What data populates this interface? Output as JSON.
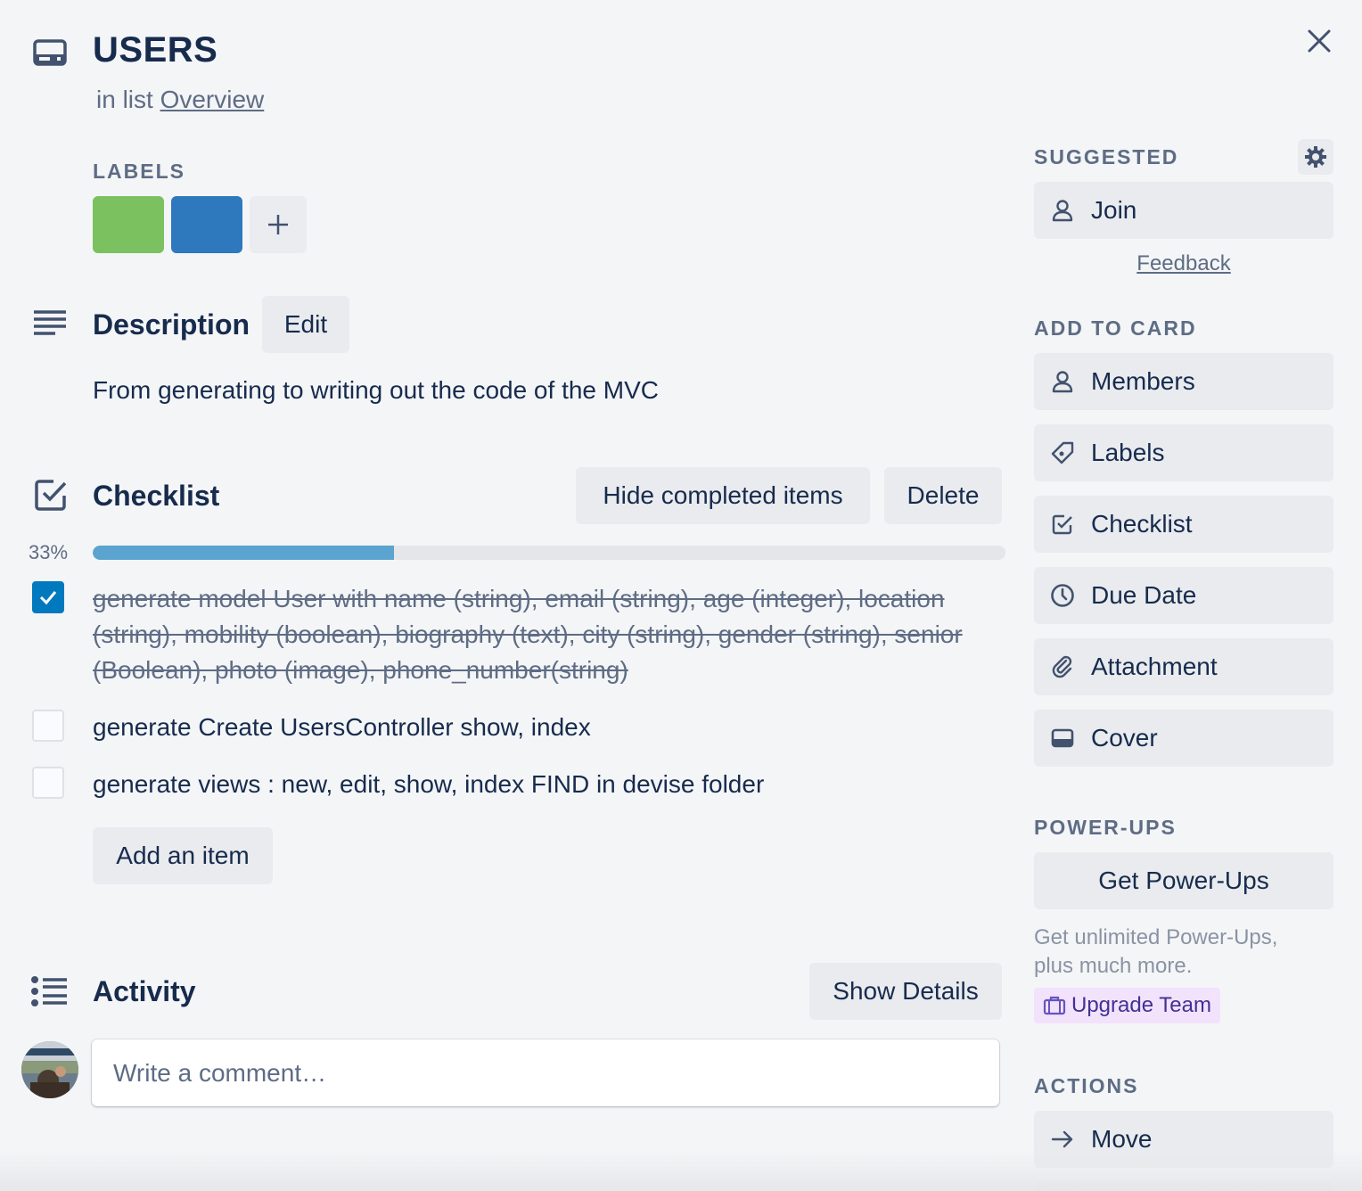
{
  "card": {
    "title": "USERS",
    "in_list_prefix": "in list",
    "list_name": "Overview"
  },
  "labels": {
    "heading": "LABELS",
    "chips": [
      {
        "color": "#7bc15f"
      },
      {
        "color": "#2e78bd"
      }
    ]
  },
  "description": {
    "heading": "Description",
    "edit_label": "Edit",
    "text": "From generating to writing out the code of the MVC"
  },
  "checklist": {
    "heading": "Checklist",
    "hide_label": "Hide completed items",
    "delete_label": "Delete",
    "percent_text": "33%",
    "progress": 0.33,
    "items": [
      {
        "checked": true,
        "text": "generate model User with name (string), email (string), age (integer), location (string), mobility (boolean), biography (text), city (string), gender (string), senior (Boolean), photo (image), phone_number(string)"
      },
      {
        "checked": false,
        "text": "generate Create UsersController show, index"
      },
      {
        "checked": false,
        "text": "generate views : new, edit, show, index FIND in devise folder"
      }
    ],
    "add_item_label": "Add an item"
  },
  "activity": {
    "heading": "Activity",
    "show_details_label": "Show Details",
    "comment_placeholder": "Write a comment…"
  },
  "sidebar": {
    "suggested_heading": "SUGGESTED",
    "join_label": "Join",
    "feedback_label": "Feedback",
    "add_to_card_heading": "ADD TO CARD",
    "add_to_card": [
      {
        "label": "Members",
        "icon": "person-icon"
      },
      {
        "label": "Labels",
        "icon": "tag-icon"
      },
      {
        "label": "Checklist",
        "icon": "checklist-icon"
      },
      {
        "label": "Due Date",
        "icon": "clock-icon"
      },
      {
        "label": "Attachment",
        "icon": "paperclip-icon"
      },
      {
        "label": "Cover",
        "icon": "cover-icon"
      }
    ],
    "powerups_heading": "POWER-UPS",
    "get_powerups_label": "Get Power-Ups",
    "powerups_desc": "Get unlimited Power-Ups, plus much more.",
    "upgrade_label": "Upgrade Team",
    "actions_heading": "ACTIONS",
    "actions": [
      {
        "label": "Move",
        "icon": "arrow-right-icon"
      }
    ]
  }
}
